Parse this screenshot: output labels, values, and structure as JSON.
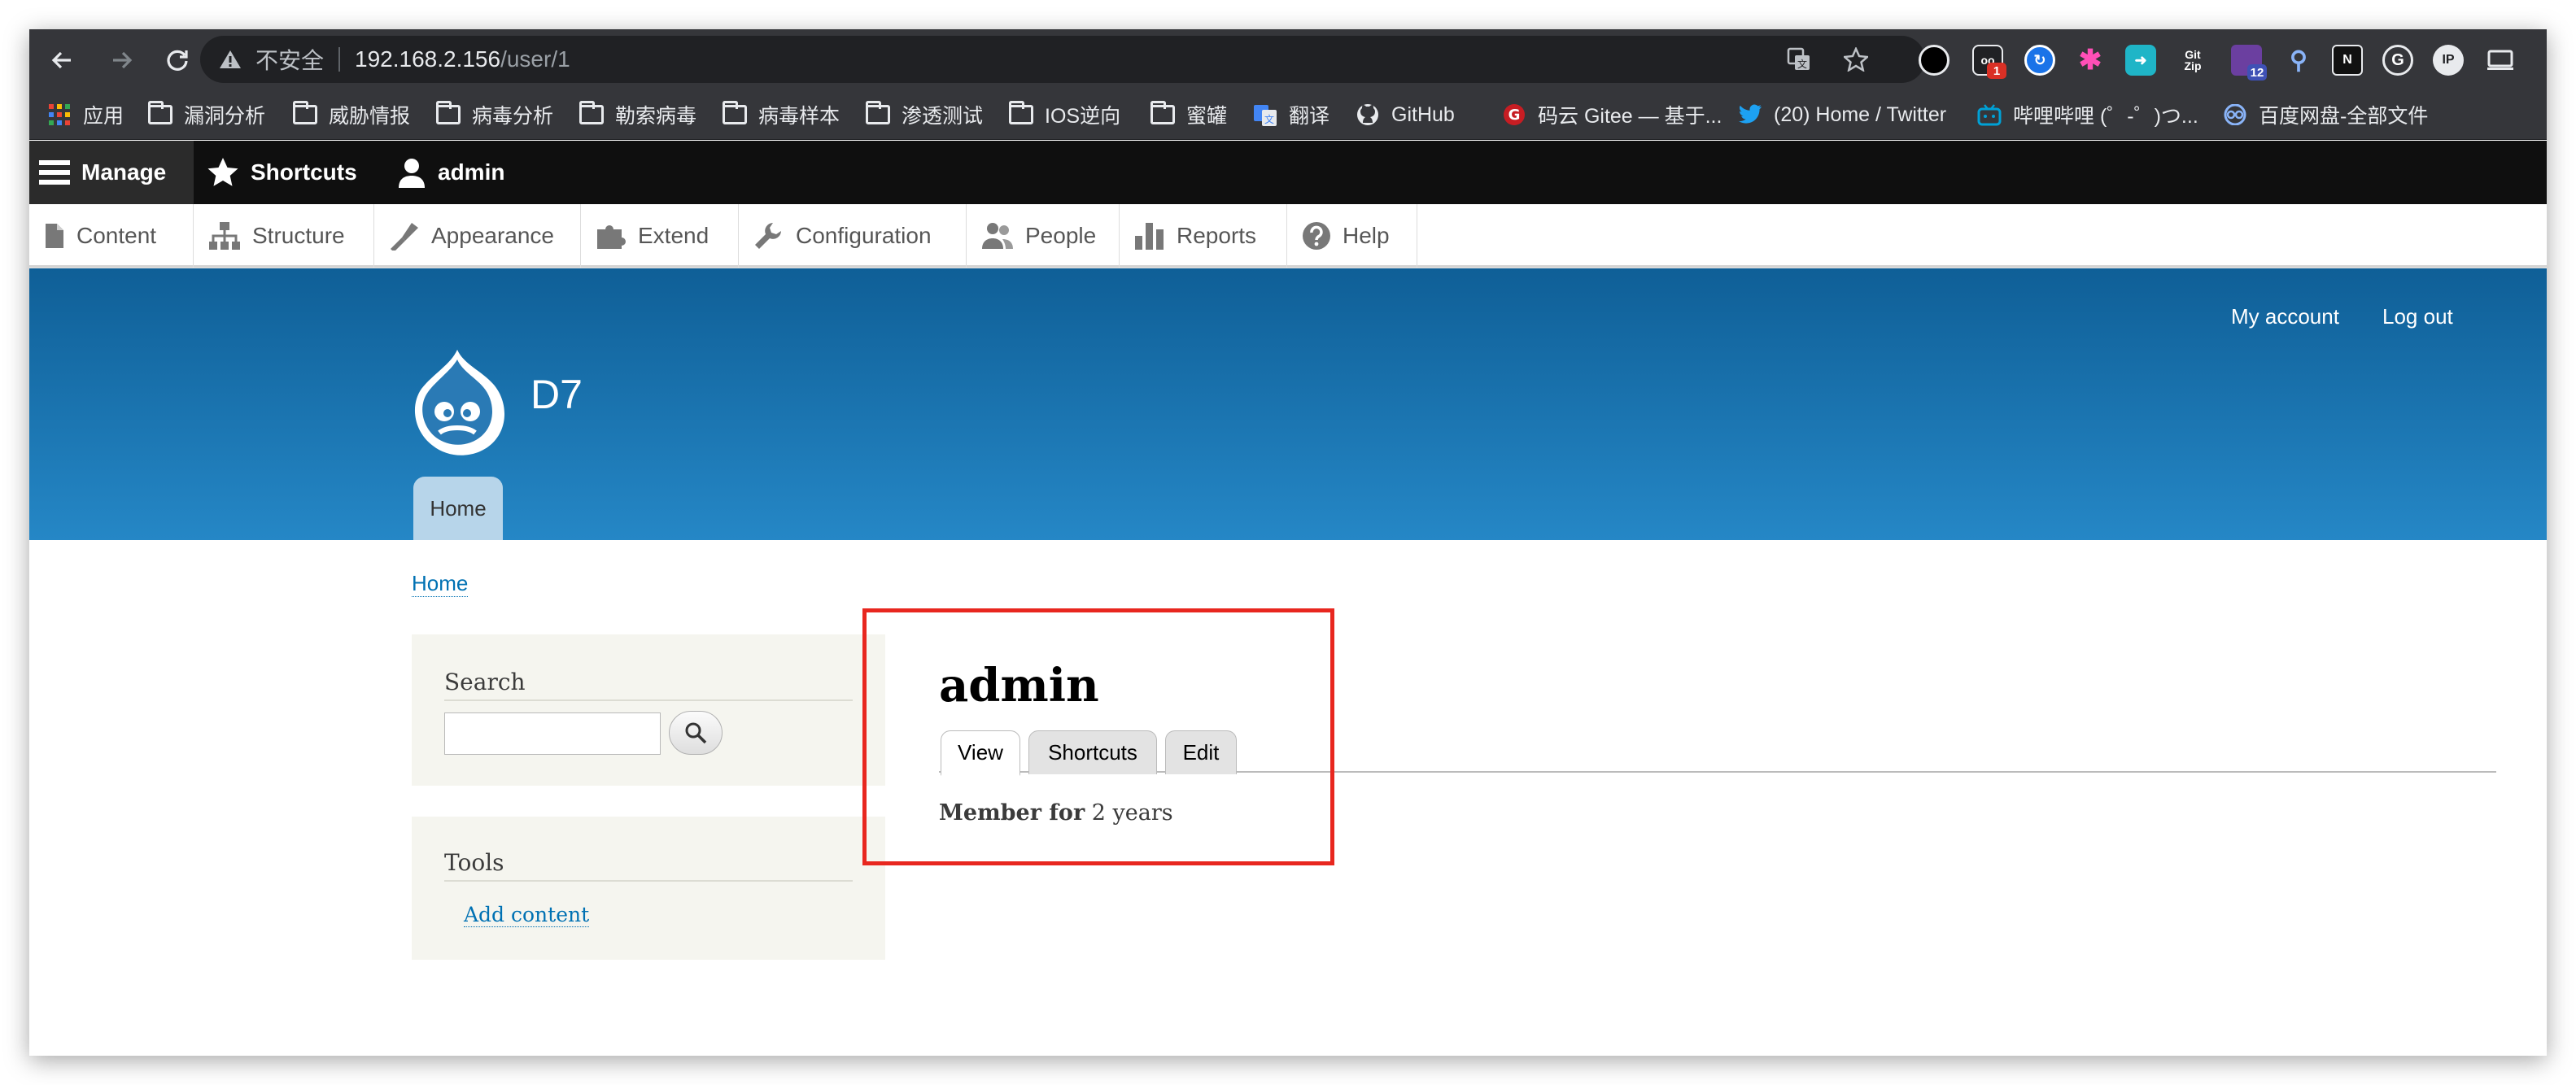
{
  "browser": {
    "insecure_label": "不安全",
    "url_host": "192.168.2.156",
    "url_path": "/user/1",
    "extension_badges": [
      "1",
      "12"
    ],
    "extension_labels": {
      "gitzip_top": "Git",
      "gitzip_bottom": "Zip"
    },
    "bookmarks": [
      "应用",
      "漏洞分析",
      "威胁情报",
      "病毒分析",
      "勒索病毒",
      "病毒样本",
      "渗透测试",
      "IOS逆向",
      "蜜罐",
      "翻译",
      "GitHub",
      "码云 Gitee — 基于...",
      "(20) Home / Twitter",
      "哔哩哔哩 (゜-゜)つ...",
      "百度网盘-全部文件"
    ]
  },
  "toolbar": {
    "manage": "Manage",
    "shortcuts": "Shortcuts",
    "user": "admin",
    "tray": [
      "Content",
      "Structure",
      "Appearance",
      "Extend",
      "Configuration",
      "People",
      "Reports",
      "Help"
    ]
  },
  "header": {
    "secondary_links": [
      "My account",
      "Log out"
    ],
    "site_name": "D7",
    "main_tab": "Home"
  },
  "breadcrumb": "Home",
  "sidebar": {
    "search_title": "Search",
    "tools_title": "Tools",
    "tools_link": "Add content"
  },
  "content": {
    "title": "admin",
    "tabs": [
      "View",
      "Shortcuts",
      "Edit"
    ],
    "active_tab": "View",
    "member_label": "Member for",
    "member_value": "2 years"
  },
  "colors": {
    "link": "#0071b3",
    "header_top": "#0f5f97",
    "header_bottom": "#2587c6",
    "highlight": "#e8271f"
  }
}
